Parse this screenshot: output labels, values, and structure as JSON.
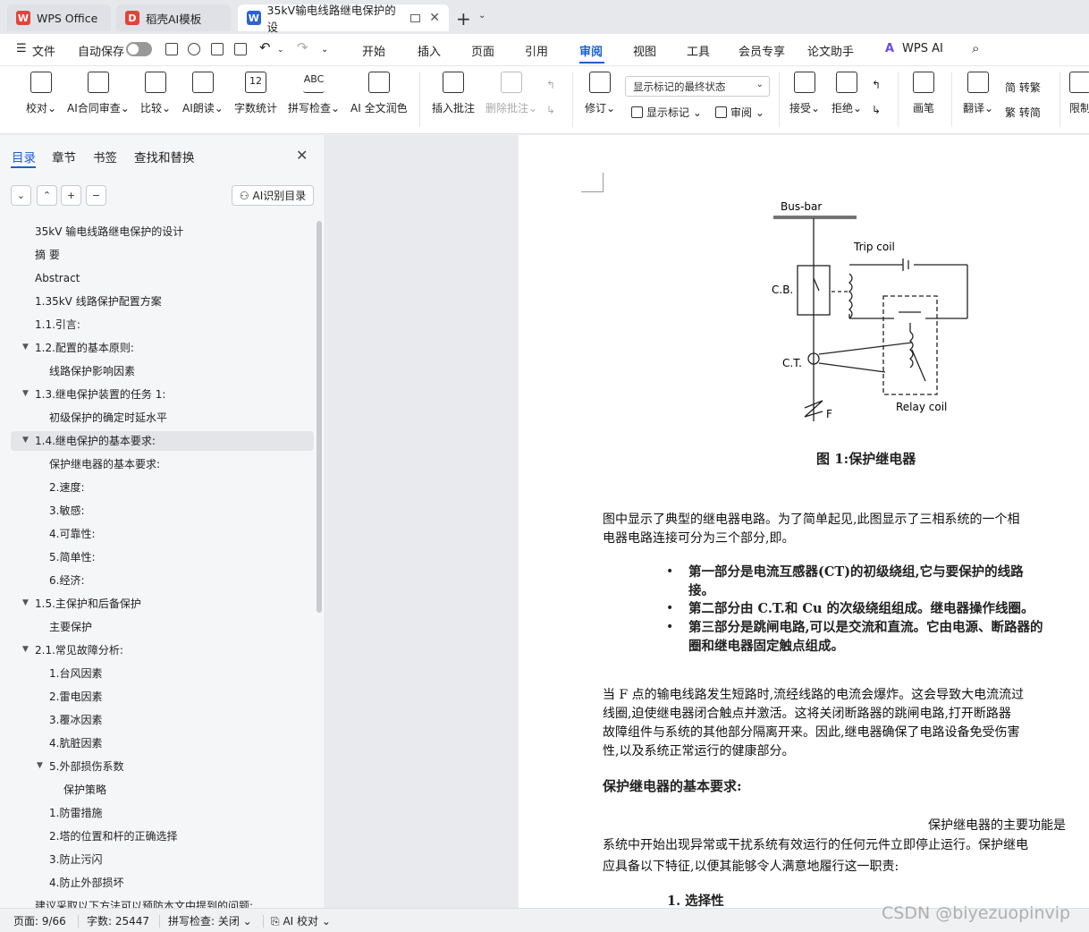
{
  "tabs": [
    {
      "label": "WPS Office",
      "logo": "W",
      "color": "#e8413a"
    },
    {
      "label": "稻壳AI模板",
      "logo": "D",
      "color": "#e8413a"
    },
    {
      "label": "35kV输电线路继电保护的设",
      "logo": "W",
      "color": "#2a62d9"
    }
  ],
  "menu": {
    "file": "文件",
    "autosave": "自动保存",
    "items": [
      "开始",
      "插入",
      "页面",
      "引用",
      "审阅",
      "视图",
      "工具",
      "会员专享",
      "论文助手",
      "WPS AI"
    ],
    "active": "审阅"
  },
  "ribbon": {
    "buttons": [
      {
        "label": "校对",
        "dd": true
      },
      {
        "label": "AI合同审查",
        "dd": true
      },
      {
        "label": "比较",
        "dd": true
      },
      {
        "label": "AI朗读",
        "dd": true
      },
      {
        "label": "字数统计",
        "dd": false
      },
      {
        "label": "拼写检查",
        "dd": true
      },
      {
        "label": "AI 全文润色",
        "dd": false
      },
      {
        "label": "插入批注",
        "dd": false
      },
      {
        "label": "删除批注",
        "dd": true
      },
      {
        "label": "修订",
        "dd": true
      },
      {
        "label": "接受",
        "dd": true
      },
      {
        "label": "拒绝",
        "dd": true
      },
      {
        "label": "画笔",
        "dd": false
      },
      {
        "label": "翻译",
        "dd": true
      },
      {
        "label": "限制",
        "dd": false
      }
    ],
    "markup_select": "显示标记的最终状态",
    "show_markup": "显示标记",
    "review": "审阅",
    "trad": "转繁",
    "simp": "转简",
    "spell_icon_text": "ABC",
    "wordcount_icon_text": "12"
  },
  "nav": {
    "tabs": [
      "目录",
      "章节",
      "书签",
      "查找和替换"
    ],
    "active_tab": "目录",
    "ai_toc": "AI识别目录",
    "items": [
      {
        "text": "35kV 输电线路继电保护的设计",
        "level": 0,
        "caret": false
      },
      {
        "text": "摘  要",
        "level": 0,
        "caret": false
      },
      {
        "text": "Abstract",
        "level": 0,
        "caret": false
      },
      {
        "text": "1.35kV 线路保护配置方案",
        "level": 0,
        "caret": false
      },
      {
        "text": "1.1.引言:",
        "level": 0,
        "caret": false
      },
      {
        "text": "1.2.配置的基本原则:",
        "level": 0,
        "caret": true
      },
      {
        "text": "线路保护影响因素",
        "level": 1,
        "caret": false
      },
      {
        "text": "1.3.继电保护装置的任务 1:",
        "level": 0,
        "caret": true
      },
      {
        "text": "初级保护的确定时延水平",
        "level": 1,
        "caret": false
      },
      {
        "text": "1.4.继电保护的基本要求:",
        "level": 0,
        "caret": true,
        "selected": true
      },
      {
        "text": "保护继电器的基本要求:",
        "level": 1,
        "caret": false
      },
      {
        "text": "2.速度:",
        "level": 1,
        "caret": false
      },
      {
        "text": "3.敏感:",
        "level": 1,
        "caret": false
      },
      {
        "text": "4.可靠性:",
        "level": 1,
        "caret": false
      },
      {
        "text": "5.简单性:",
        "level": 1,
        "caret": false
      },
      {
        "text": "6.经济:",
        "level": 1,
        "caret": false
      },
      {
        "text": "1.5.主保护和后备保护",
        "level": 0,
        "caret": true
      },
      {
        "text": "主要保护",
        "level": 1,
        "caret": false
      },
      {
        "text": "2.1.常见故障分析:",
        "level": 0,
        "caret": true
      },
      {
        "text": "1.台风因素",
        "level": 1,
        "caret": false
      },
      {
        "text": "2.雷电因素",
        "level": 1,
        "caret": false
      },
      {
        "text": "3.覆冰因素",
        "level": 1,
        "caret": false
      },
      {
        "text": "4.肮脏因素",
        "level": 1,
        "caret": false
      },
      {
        "text": "5.外部损伤系数",
        "level": 1,
        "caret": true
      },
      {
        "text": "保护策略",
        "level": 2,
        "caret": false
      },
      {
        "text": "1.防雷措施",
        "level": 1,
        "caret": false
      },
      {
        "text": "2.塔的位置和杆的正确选择",
        "level": 1,
        "caret": false
      },
      {
        "text": "3.防止污闪",
        "level": 1,
        "caret": false
      },
      {
        "text": "4.防止外部损坏",
        "level": 1,
        "caret": false
      },
      {
        "text": "建议采取以下方法可以预防本文中提到的问题:",
        "level": 0,
        "caret": false
      }
    ]
  },
  "figure": {
    "labels": [
      "Bus-bar",
      "Trip coil",
      "C.B.",
      "C.T.",
      "F",
      "Relay coil"
    ],
    "caption": "图 1:保护继电器"
  },
  "doc": {
    "p1": [
      "图中显示了典型的继电器电路。为了简单起见,此图显示了三相系统的一个相",
      "电器电路连接可分为三个部分,即。"
    ],
    "bullets": [
      "第一部分是电流互感器(CT)的初级绕组,它与要保护的线路",
      "接。",
      "第二部分由 C.T.和 Cu 的次级绕组组成。继电器操作线圈。",
      "第三部分是跳闸电路,可以是交流和直流。它由电源、断路器的",
      "圈和继电器固定触点组成。"
    ],
    "p2": [
      "当 F 点的输电线路发生短路时,流经线路的电流会爆炸。这会导致大电流流过",
      "线圈,迫使继电器闭合触点并激活。这将关闭断路器的跳闸电路,打开断路器",
      "故障组件与系统的其他部分隔离开来。因此,继电器确保了电路设备免受伤害",
      "性,以及系统正常运行的健康部分。"
    ],
    "heading": "保护继电器的基本要求:",
    "p3": [
      "保护继电器的主要功能是",
      "系统中开始出现异常或干扰系统有效运行的任何元件立即停止运行。保护继电",
      "应具备以下特征,以便其能够令人满意地履行这一职责:"
    ],
    "numbered": "1.  选择性"
  },
  "status": {
    "page": "页面: 9/66",
    "words": "字数: 25447",
    "spell": "拼写检查: 关闭",
    "ai": "AI 校对"
  },
  "watermark": "CSDN @biyezuopinvip"
}
